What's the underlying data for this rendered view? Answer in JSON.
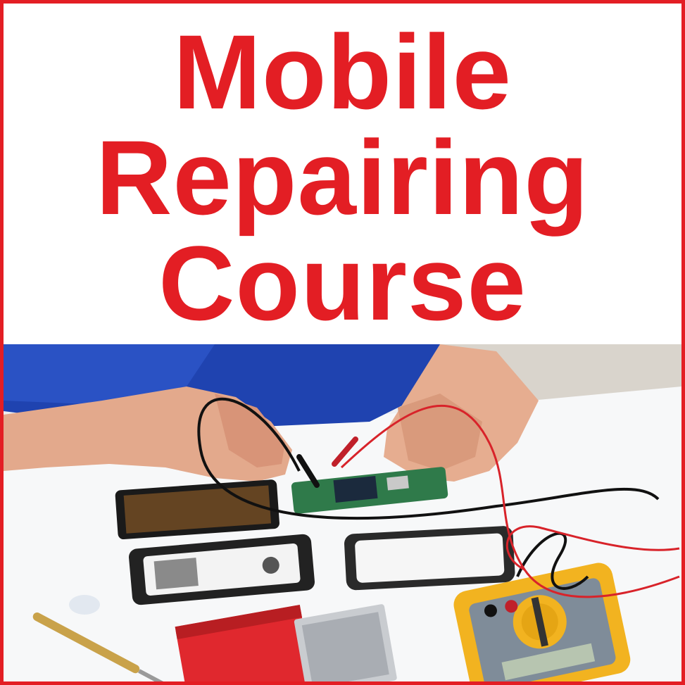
{
  "title": {
    "lines": [
      "Mobile",
      "Repairing",
      "Course"
    ]
  },
  "colors": {
    "accent": "#e31e24",
    "background": "#ffffff",
    "shirt": "#1d3fa8",
    "multimeter": "#f2b320"
  },
  "photo": {
    "subject": "technician-repairing-phone-with-multimeter"
  }
}
